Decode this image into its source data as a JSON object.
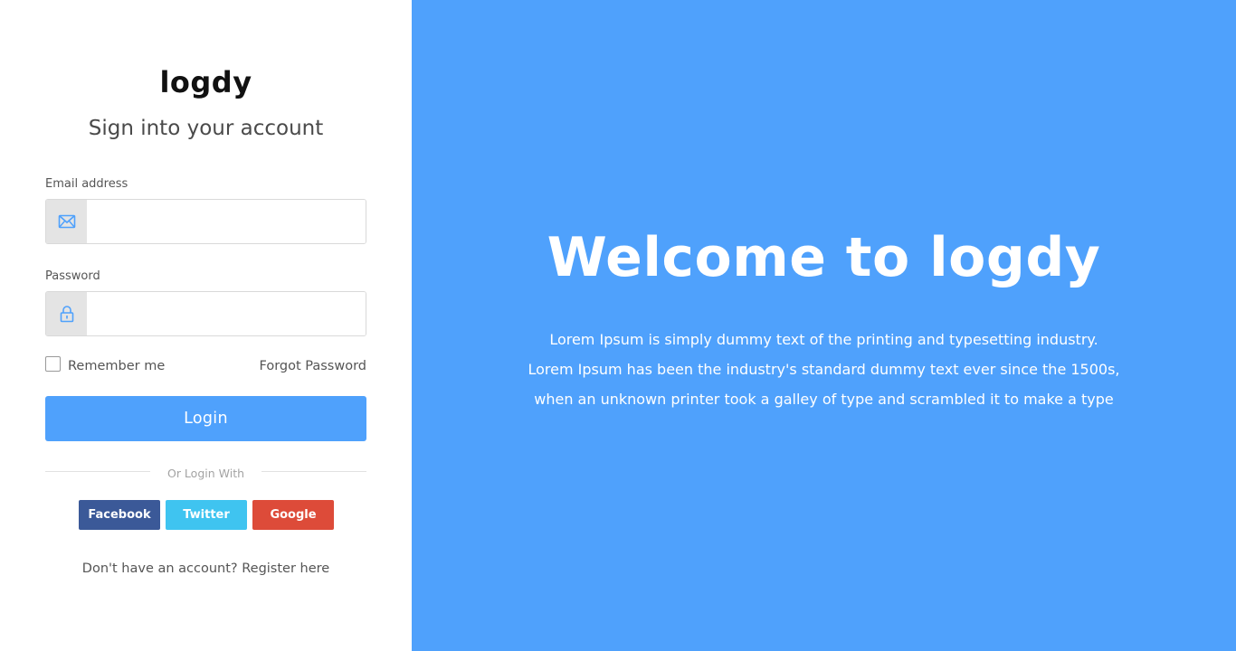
{
  "brand": {
    "logo_text": "logdy"
  },
  "login_form": {
    "title": "Sign into your account",
    "email": {
      "label": "Email address",
      "value": "",
      "placeholder": "",
      "icon": "envelope-icon"
    },
    "password": {
      "label": "Password",
      "value": "",
      "placeholder": "",
      "icon": "lock-icon"
    },
    "remember_label": "Remember me",
    "remember_checked": false,
    "forgot_label": "Forgot Password",
    "login_label": "Login",
    "divider_text": "Or Login With",
    "social": {
      "facebook": "Facebook",
      "twitter": "Twitter",
      "google": "Google"
    },
    "register_prompt": "Don't have an account?",
    "register_link": "Register here"
  },
  "welcome": {
    "heading": "Welcome to logdy",
    "lines": [
      "Lorem Ipsum is simply dummy text of the printing and typesetting industry.",
      "Lorem Ipsum has been the industry's standard dummy text ever since the 1500s,",
      "when an unknown printer took a galley of type and scrambled it to make a type"
    ]
  },
  "colors": {
    "accent": "#4fa1fc",
    "facebook": "#3b5998",
    "twitter": "#3fc4f0",
    "google": "#dd4b39"
  }
}
